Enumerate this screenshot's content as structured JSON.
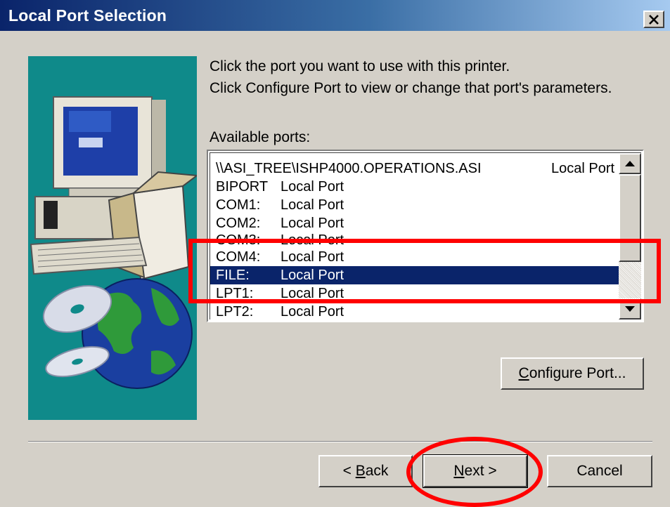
{
  "window": {
    "title": "Local Port Selection",
    "close_icon": "close-icon"
  },
  "instructions": {
    "line1": "Click the port you want to use with this printer.",
    "line2": "Click Configure Port to view or change that port's parameters."
  },
  "ports": {
    "label": "Available ports:",
    "selected_index": 6,
    "items": [
      {
        "name": "\\\\ASI_TREE\\ISHP4000.OPERATIONS.ASI",
        "desc": "Local Port"
      },
      {
        "name": "BIPORT",
        "desc": "Local Port"
      },
      {
        "name": "COM1:",
        "desc": "Local Port"
      },
      {
        "name": "COM2:",
        "desc": "Local Port"
      },
      {
        "name": "COM3:",
        "desc": "Local Port"
      },
      {
        "name": "COM4:",
        "desc": "Local Port"
      },
      {
        "name": "FILE:",
        "desc": "Local Port"
      },
      {
        "name": "LPT1:",
        "desc": "Local Port"
      },
      {
        "name": "LPT2:",
        "desc": "Local Port"
      }
    ]
  },
  "buttons": {
    "configure_pre": "",
    "configure_key": "C",
    "configure_post": "onfigure Port...",
    "back_pre": "< ",
    "back_key": "B",
    "back_post": "ack",
    "next_pre": "",
    "next_key": "N",
    "next_post": "ext >",
    "cancel": "Cancel"
  },
  "colors": {
    "title_bar": "#0a246a",
    "selection": "#0a246a",
    "annotation": "#ff0000",
    "art_background": "#0f8a8a"
  }
}
